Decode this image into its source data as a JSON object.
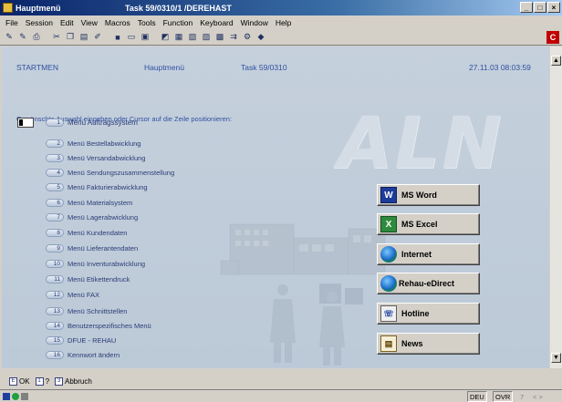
{
  "window": {
    "title_app": "Hauptmenü",
    "title_task": "Task 59/0310/1 /DEREHAST",
    "btn_min": "_",
    "btn_max": "□",
    "btn_close": "×"
  },
  "menubar": [
    "File",
    "Session",
    "Edit",
    "View",
    "Macros",
    "Tools",
    "Function",
    "Keyboard",
    "Window",
    "Help"
  ],
  "screen": {
    "left_code": "STARTMEN",
    "center_title": "Hauptmenü",
    "task": "Task 59/0310",
    "datetime": "27.11.03  08:03:59",
    "instruction": "Gewünschte Auswahl eingeben oder Cursor auf die Zeile positionieren:",
    "watermark": "ALN",
    "menu_items": [
      {
        "num": "1",
        "label": "Menü Auftragssystem"
      },
      {
        "num": "2",
        "label": "Menü Bestellabwicklung"
      },
      {
        "num": "3",
        "label": "Menü Versandabwicklung"
      },
      {
        "num": "4",
        "label": "Menü Sendungszusammenstellung"
      },
      {
        "num": "5",
        "label": "Menü Fakturierabwicklung"
      },
      {
        "num": "6",
        "label": "Menü Materialsystem"
      },
      {
        "num": "7",
        "label": "Menü Lagerabwicklung"
      },
      {
        "num": "8",
        "label": "Menü Kundendaten"
      },
      {
        "num": "9",
        "label": "Menü Lieferantendaten"
      },
      {
        "num": "10",
        "label": "Menü Inventurabwicklung"
      },
      {
        "num": "11",
        "label": "Menü Etikettendruck"
      },
      {
        "num": "12",
        "label": "Menü FAX"
      },
      {
        "num": "13",
        "label": "Menü Schnittstellen"
      },
      {
        "num": "14",
        "label": "Benutzerspezifisches Menü"
      },
      {
        "num": "15",
        "label": "DFUE - REHAU"
      },
      {
        "num": "16",
        "label": "Kennwort ändern"
      }
    ],
    "actions": [
      {
        "label": "MS Word",
        "icon": "word-icon"
      },
      {
        "label": "MS Excel",
        "icon": "excel-icon"
      },
      {
        "label": "Internet",
        "icon": "globe-icon"
      },
      {
        "label": "Rehau-eDirect",
        "icon": "globe-icon"
      },
      {
        "label": "Hotline",
        "icon": "phone-icon"
      },
      {
        "label": "News",
        "icon": "newspaper-icon"
      }
    ]
  },
  "fkeys": [
    {
      "key": "E",
      "label": "OK"
    },
    {
      "key": "1",
      "label": "?"
    },
    {
      "key": "3",
      "label": "Abbruch"
    }
  ],
  "status": {
    "lang": "DEU",
    "mode": "OVR",
    "pos": "7",
    "extra": "< >"
  },
  "colors": {
    "screen_bg": "#c5d0dc",
    "text_blue": "#3050a0",
    "title_bar": "#0a246a"
  }
}
